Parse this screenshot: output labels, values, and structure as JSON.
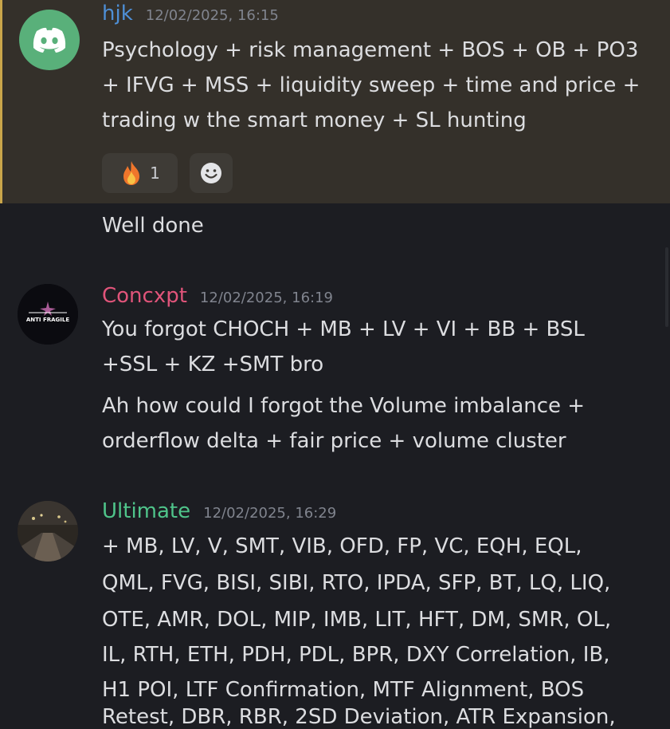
{
  "messages": [
    {
      "username": "hjk",
      "username_color": "#4e8fd6",
      "timestamp": "12/02/2025, 16:15",
      "avatar_icon": "discord-icon",
      "highlighted": true,
      "lines": [
        "Psychology + risk management + BOS + OB + PO3",
        "+ IFVG + MSS + liquidity sweep + time and price +",
        "trading w the smart money + SL hunting"
      ],
      "reaction": {
        "emoji": "fire-emoji",
        "count": "1"
      },
      "add_reaction_icon": "smiley-icon"
    },
    {
      "continuation": true,
      "lines": [
        "Well done"
      ]
    },
    {
      "username": "Concxpt",
      "username_color": "#e0547a",
      "timestamp": "12/02/2025, 16:19",
      "avatar_text": "ANTI FRAGILE",
      "lines": [
        "You forgot CHOCH + MB + LV + VI + BB + BSL",
        "+SSL + KZ +SMT bro"
      ]
    },
    {
      "continuation": true,
      "lines": [
        "Ah how could I forgot the Volume imbalance +",
        "orderflow delta + fair price + volume cluster"
      ]
    },
    {
      "username": "Ultimate",
      "username_color": "#4fc48a",
      "timestamp": "12/02/2025, 16:29",
      "lines": [
        "+ MB, LV, V, SMT, VIB, OFD, FP, VC, EQH, EQL,",
        "QML, FVG, BISI, SIBI, RTO, IPDA, SFP, BT, LQ, LIQ,",
        "OTE, AMR, DOL, MIP, IMB, LIT, HFT, DM, SMR, OL,",
        "IL, RTH, ETH, PDH, PDL, BPR, DXY Correlation, IB,",
        "H1 POI, LTF Confirmation, MTF Alignment, BOS",
        "Retest, DBR, RBR, 2SD Deviation, ATR Expansion,"
      ]
    }
  ]
}
